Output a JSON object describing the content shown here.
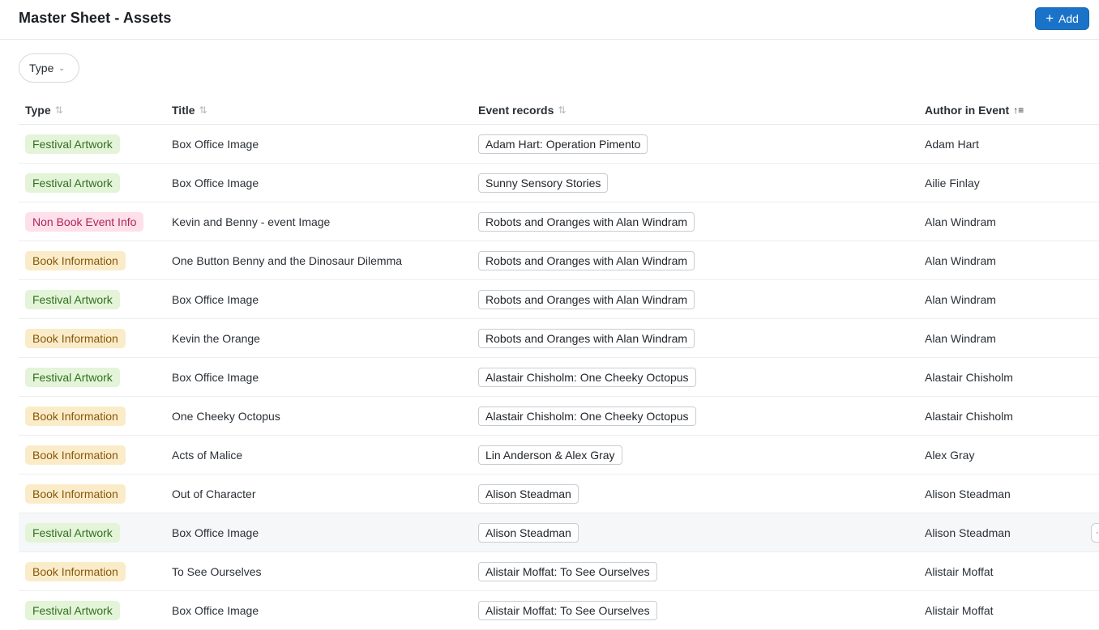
{
  "header": {
    "title": "Master Sheet - Assets",
    "add_label": "Add",
    "add_icon": "plus-icon",
    "accent": "#1a73c8"
  },
  "filters": {
    "type_label": "Type",
    "type_icon": "chevron-down-icon"
  },
  "columns": [
    {
      "label": "Type",
      "sort_icon": "sort-icon"
    },
    {
      "label": "Title",
      "sort_icon": "sort-icon"
    },
    {
      "label": "Event records",
      "sort_icon": "sort-icon"
    },
    {
      "label": "Author in Event",
      "sort_icon": "sort-ascending-icon"
    }
  ],
  "badge_colors": {
    "festival": "#e3f4d9",
    "book": "#fbecc9",
    "nonbook": "#fde0ea"
  },
  "rows": [
    {
      "type": "Festival Artwork",
      "type_kind": "festival",
      "title": "Box Office Image",
      "event": "Adam Hart: Operation Pimento",
      "author": "Adam Hart"
    },
    {
      "type": "Festival Artwork",
      "type_kind": "festival",
      "title": "Box Office Image",
      "event": "Sunny Sensory Stories",
      "author": "Ailie Finlay"
    },
    {
      "type": "Non Book Event Info",
      "type_kind": "nonbook",
      "title": "Kevin and Benny - event Image",
      "event": "Robots and Oranges with Alan Windram",
      "author": "Alan Windram"
    },
    {
      "type": "Book Information",
      "type_kind": "book",
      "title": "One Button Benny and the Dinosaur Dilemma",
      "event": "Robots and Oranges with Alan Windram",
      "author": "Alan Windram"
    },
    {
      "type": "Festival Artwork",
      "type_kind": "festival",
      "title": "Box Office Image",
      "event": "Robots and Oranges with Alan Windram",
      "author": "Alan Windram"
    },
    {
      "type": "Book Information",
      "type_kind": "book",
      "title": "Kevin the Orange",
      "event": "Robots and Oranges with Alan Windram",
      "author": "Alan Windram"
    },
    {
      "type": "Festival Artwork",
      "type_kind": "festival",
      "title": "Box Office Image",
      "event": "Alastair Chisholm: One Cheeky Octopus",
      "author": "Alastair Chisholm"
    },
    {
      "type": "Book Information",
      "type_kind": "book",
      "title": "One Cheeky Octopus",
      "event": "Alastair Chisholm: One Cheeky Octopus",
      "author": "Alastair Chisholm"
    },
    {
      "type": "Book Information",
      "type_kind": "book",
      "title": "Acts of Malice",
      "event": "Lin Anderson & Alex Gray",
      "author": "Alex Gray"
    },
    {
      "type": "Book Information",
      "type_kind": "book",
      "title": "Out of Character",
      "event": "Alison Steadman",
      "author": "Alison Steadman"
    },
    {
      "type": "Festival Artwork",
      "type_kind": "festival",
      "title": "Box Office Image",
      "event": "Alison Steadman",
      "author": "Alison Steadman",
      "highlighted": true
    },
    {
      "type": "Book Information",
      "type_kind": "book",
      "title": "To See Ourselves",
      "event": "Alistair Moffat: To See Ourselves",
      "author": "Alistair Moffat"
    },
    {
      "type": "Festival Artwork",
      "type_kind": "festival",
      "title": "Box Office Image",
      "event": "Alistair Moffat: To See Ourselves",
      "author": "Alistair Moffat"
    }
  ]
}
